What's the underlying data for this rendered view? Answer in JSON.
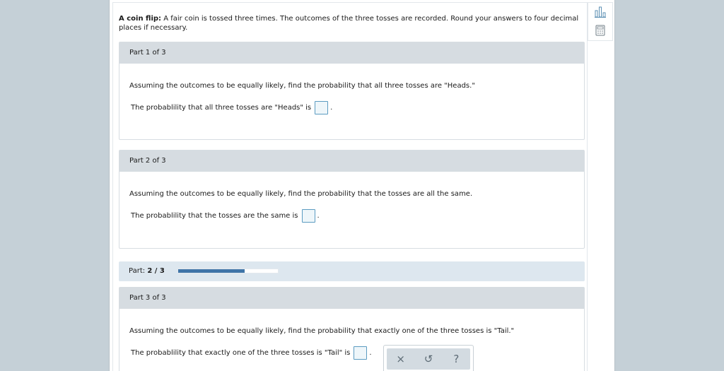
{
  "problem": {
    "title": "A coin flip:",
    "text": " A fair coin is tossed three times. The outcomes of the three tosses are recorded. Round your answers to four decimal places if necessary."
  },
  "parts": [
    {
      "header": "Part 1 of 3",
      "question": "Assuming the outcomes to be equally likely, find the probability that all three tosses are \"Heads.\"",
      "answer_label": "The probablility that all three tosses are \"Heads\" is",
      "answer_suffix": ".",
      "answer_value": ""
    },
    {
      "header": "Part 2 of 3",
      "question": "Assuming the outcomes to be equally likely, find the probability that the tosses are all the same.",
      "answer_label": "The probablility that the tosses are the same is",
      "answer_suffix": ".",
      "answer_value": ""
    },
    {
      "header": "Part 3 of 3",
      "question": "Assuming the outcomes to be equally likely, find the probability that exactly one of the three tosses is \"Tail.\"",
      "answer_label": "The probablility that exactly one of the three tosses is \"Tail\" is",
      "answer_suffix": ".",
      "answer_value": ""
    }
  ],
  "progress": {
    "label": "Part:",
    "value": "2 / 3",
    "fraction": 0.667,
    "fill_color": "#3f75a8"
  },
  "actions": {
    "clear_glyph": "×",
    "undo_glyph": "↺",
    "help_glyph": "?"
  },
  "tools": [
    "bar-chart-icon",
    "calculator-icon"
  ],
  "colors": {
    "background": "#c5d0d7",
    "part_header": "#d6dce1",
    "answer_border": "#5b9bc1"
  }
}
